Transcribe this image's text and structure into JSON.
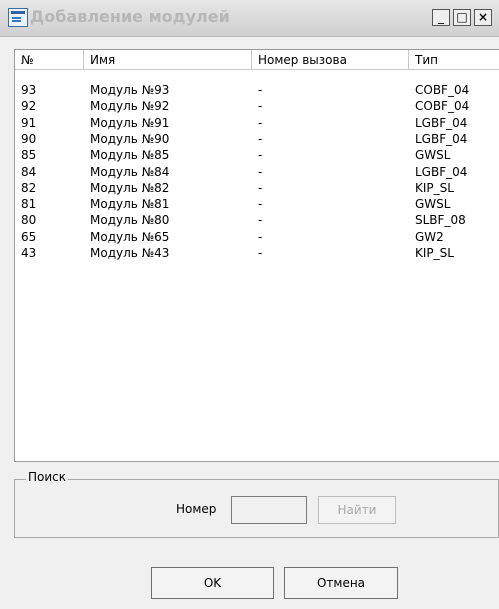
{
  "window": {
    "title": "Добавление модулей",
    "minimize_glyph": "_",
    "maximize_glyph": "□",
    "close_glyph": "×"
  },
  "table": {
    "columns": [
      "№",
      "Имя",
      "Номер вызова",
      "Тип"
    ],
    "rows": [
      {
        "num": "93",
        "name": "Модуль №93",
        "call": "-",
        "type": "COBF_04"
      },
      {
        "num": "92",
        "name": "Модуль №92",
        "call": "-",
        "type": "COBF_04"
      },
      {
        "num": "91",
        "name": "Модуль №91",
        "call": "-",
        "type": "LGBF_04"
      },
      {
        "num": "90",
        "name": "Модуль №90",
        "call": "-",
        "type": "LGBF_04"
      },
      {
        "num": "85",
        "name": "Модуль №85",
        "call": "-",
        "type": "GWSL"
      },
      {
        "num": "84",
        "name": "Модуль №84",
        "call": "-",
        "type": "LGBF_04"
      },
      {
        "num": "82",
        "name": "Модуль №82",
        "call": "-",
        "type": "KIP_SL"
      },
      {
        "num": "81",
        "name": "Модуль №81",
        "call": "-",
        "type": "GWSL"
      },
      {
        "num": "80",
        "name": "Модуль №80",
        "call": "-",
        "type": "SLBF_08"
      },
      {
        "num": "65",
        "name": "Модуль №65",
        "call": "-",
        "type": "GW2"
      },
      {
        "num": "43",
        "name": "Модуль №43",
        "call": "-",
        "type": "KIP_SL"
      }
    ]
  },
  "scroll": {
    "left_glyph": "◀",
    "right_glyph": "▶"
  },
  "search": {
    "legend": "Поиск",
    "number_label": "Номер",
    "number_value": "",
    "find_button": "Найти"
  },
  "footer": {
    "ok_button": "OK",
    "cancel_button": "Отмена"
  }
}
